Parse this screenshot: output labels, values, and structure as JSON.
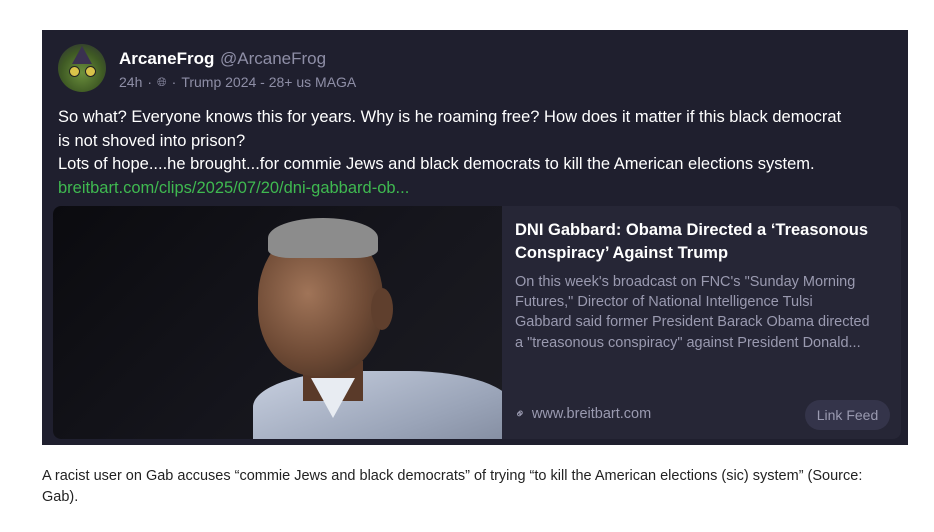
{
  "post": {
    "author_name": "ArcaneFrog",
    "author_handle": "@ArcaneFrog",
    "time": "24h",
    "globe_icon": "globe-icon",
    "meta_separator_1": "·",
    "meta_separator_2": "·",
    "meta_bio": "Trump 2024 - 28+ us MAGA",
    "text_lines": [
      "So what? Everyone knows this for years. Why is he roaming free? How does it matter if this black democrat",
      "is not shoved into prison?",
      "Lots of hope....he brought...for commie Jews and black democrats to kill the American elections system."
    ],
    "link_text": "breitbart.com/clips/2025/07/20/dni-gabbard-ob..."
  },
  "card": {
    "title_lines": [
      "DNI Gabbard: Obama Directed a ‘Treasonous",
      "Conspiracy’ Against Trump"
    ],
    "desc_lines": [
      "On this week's broadcast on FNC's \"Sunday Morning",
      "Futures,\" Director of National Intelligence Tulsi",
      "Gabbard said former President Barack Obama directed",
      "a \"treasonous conspiracy\" against President Donald..."
    ],
    "domain": "www.breitbart.com",
    "link_feed_label": "Link Feed"
  },
  "caption": {
    "line1": "A racist user on Gab accuses “commie Jews and black democrats” of trying “to kill the American elections (sic) system” (Source:",
    "line2": "Gab)."
  },
  "colors": {
    "post_bg": "#1f1f2e",
    "card_bg": "#262636",
    "link_green": "#3fb950",
    "muted_text": "#8e8ea6"
  }
}
